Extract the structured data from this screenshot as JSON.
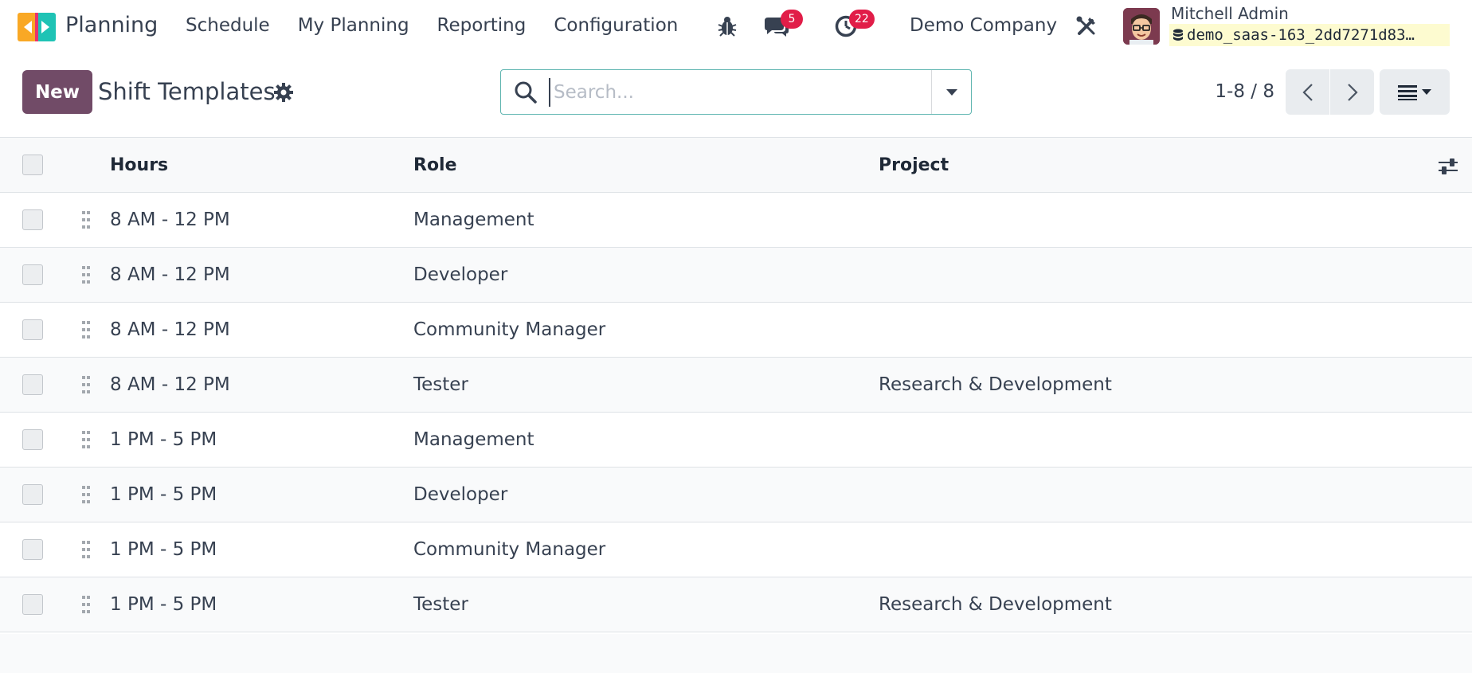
{
  "navbar": {
    "app_name": "Planning",
    "menu": [
      "Schedule",
      "My Planning",
      "Reporting",
      "Configuration"
    ],
    "messages_count": "5",
    "activities_count": "22",
    "company": "Demo Company",
    "user_name": "Mitchell Admin",
    "database": "demo_saas-163_2dd7271d83…"
  },
  "control_panel": {
    "new_label": "New",
    "title": "Shift Templates",
    "search_placeholder": "Search...",
    "pager": "1-8 / 8"
  },
  "list": {
    "columns": {
      "hours": "Hours",
      "role": "Role",
      "project": "Project"
    },
    "rows": [
      {
        "hours": "8 AM - 12 PM",
        "role": "Management",
        "project": ""
      },
      {
        "hours": "8 AM - 12 PM",
        "role": "Developer",
        "project": ""
      },
      {
        "hours": "8 AM - 12 PM",
        "role": "Community Manager",
        "project": ""
      },
      {
        "hours": "8 AM - 12 PM",
        "role": "Tester",
        "project": "Research & Development"
      },
      {
        "hours": "1 PM - 5 PM",
        "role": "Management",
        "project": ""
      },
      {
        "hours": "1 PM - 5 PM",
        "role": "Developer",
        "project": ""
      },
      {
        "hours": "1 PM - 5 PM",
        "role": "Community Manager",
        "project": ""
      },
      {
        "hours": "1 PM - 5 PM",
        "role": "Tester",
        "project": "Research & Development"
      }
    ]
  },
  "colors": {
    "brand": "#714b67",
    "badge": "#e11d48",
    "search_border": "#5fb5b0",
    "logo_orange": "#f9a825",
    "logo_teal": "#1fc3b5",
    "logo_pink": "#e8326d"
  },
  "icons": {
    "bug": "bug-icon",
    "messages": "chat-icon",
    "activities": "clock-icon",
    "settings": "tools-icon",
    "title_gear": "gear-icon",
    "search": "search-icon",
    "search_toggle": "caret-down-icon",
    "prev": "chevron-left-icon",
    "next": "chevron-right-icon",
    "view": "list-view-icon",
    "optional_columns": "sliders-icon",
    "handle": "drag-handle-icon"
  }
}
